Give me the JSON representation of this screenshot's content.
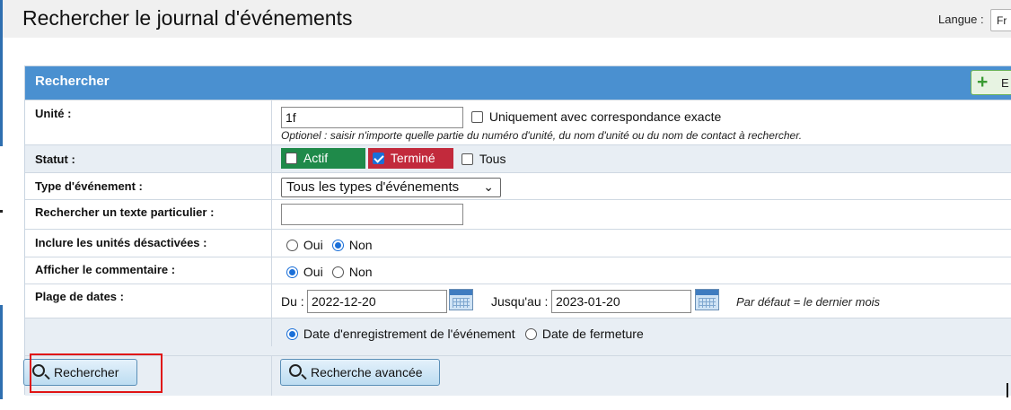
{
  "header": {
    "title": "Rechercher le journal d'événements",
    "language_label": "Langue :",
    "language_value": "Fr"
  },
  "panel": {
    "title": "Rechercher",
    "add_button_label": "E"
  },
  "form": {
    "unit": {
      "label": "Unité :",
      "value": "1f",
      "exact_match_label": "Uniquement avec correspondance exacte",
      "exact_match_checked": false,
      "hint": "Optionel : saisir n'importe quelle partie du numéro d'unité, du nom d'unité ou du nom de contact à rechercher."
    },
    "status": {
      "label": "Statut :",
      "actif_label": "Actif",
      "termine_label": "Terminé",
      "tous_label": "Tous",
      "actif_color": "#1f8a4a",
      "termine_color": "#c22a3c"
    },
    "event_type": {
      "label": "Type d'événement :",
      "selected": "Tous les types d'événements"
    },
    "search_text": {
      "label": "Rechercher un texte particulier :",
      "value": ""
    },
    "include_disabled": {
      "label": "Inclure les unités désactivées :",
      "oui": "Oui",
      "non": "Non",
      "selected": "Non"
    },
    "show_comment": {
      "label": "Afficher le commentaire :",
      "oui": "Oui",
      "non": "Non",
      "selected": "Oui"
    },
    "date_range": {
      "label": "Plage de dates :",
      "from_label": "Du :",
      "from_value": "2022-12-20",
      "to_label": "Jusqu'au :",
      "to_value": "2023-01-20",
      "default_hint": "Par défaut = le dernier mois"
    },
    "date_mode": {
      "registration_label": "Date d'enregistrement de l'événement",
      "closing_label": "Date de fermeture",
      "selected": "registration"
    }
  },
  "actions": {
    "search_label": "Rechercher",
    "advanced_label": "Recherche avancée"
  },
  "colors": {
    "panel_header": "#4a90d0",
    "highlight": "#e01515"
  }
}
